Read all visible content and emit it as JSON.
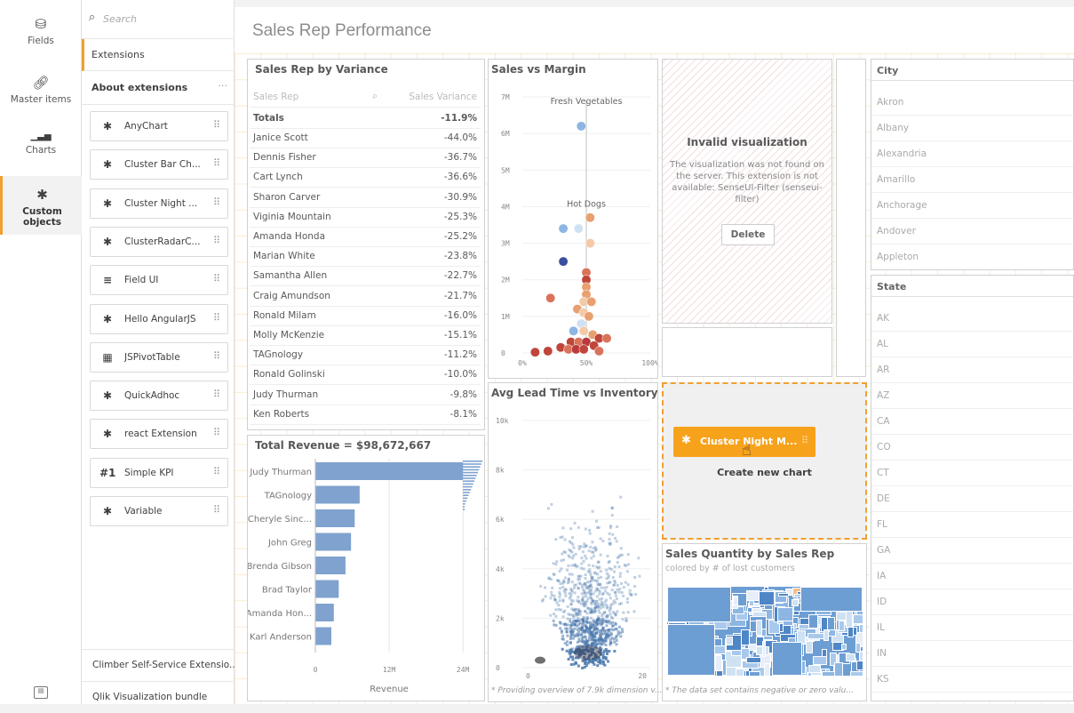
{
  "rail": {
    "items": [
      {
        "label": "Fields",
        "icon": "database-icon"
      },
      {
        "label": "Master items",
        "icon": "link-icon"
      },
      {
        "label": "Charts",
        "icon": "bar-chart-icon"
      },
      {
        "label": "Custom objects",
        "icon": "puzzle-icon"
      }
    ]
  },
  "panel": {
    "search_placeholder": "Search",
    "tab": "Extensions",
    "section": "About extensions",
    "extensions": [
      {
        "label": "AnyChart",
        "icon": "puzzle-icon",
        "glyph": "✱"
      },
      {
        "label": "Cluster Bar Ch...",
        "icon": "puzzle-icon",
        "glyph": "✱"
      },
      {
        "label": "Cluster Night ...",
        "icon": "puzzle-icon",
        "glyph": "✱"
      },
      {
        "label": "ClusterRadarC...",
        "icon": "puzzle-icon",
        "glyph": "✱"
      },
      {
        "label": "Field UI",
        "icon": "list-icon",
        "glyph": "≡"
      },
      {
        "label": "Hello AngularJS",
        "icon": "puzzle-icon",
        "glyph": "✱"
      },
      {
        "label": "JSPivotTable",
        "icon": "table-icon",
        "glyph": "▦"
      },
      {
        "label": "QuickAdhoc",
        "icon": "puzzle-icon",
        "glyph": "✱"
      },
      {
        "label": "react Extension",
        "icon": "puzzle-icon",
        "glyph": "✱"
      },
      {
        "label": "Simple KPI",
        "icon": "kpi-icon",
        "glyph": "#1"
      },
      {
        "label": "Variable",
        "icon": "puzzle-icon",
        "glyph": "✱"
      }
    ],
    "bundles": [
      "Climber Self-Service Extensio...",
      "Qlik Visualization bundle"
    ]
  },
  "sheet": {
    "title": "Sales Rep Performance",
    "variance": {
      "title": "Sales Rep by Variance",
      "col1": "Sales Rep",
      "col2": "Sales Variance",
      "totals_label": "Totals",
      "totals_value": "-11.9%",
      "rows": [
        [
          "Janice Scott",
          "-44.0%"
        ],
        [
          "Dennis Fisher",
          "-36.7%"
        ],
        [
          "Cart Lynch",
          "-36.6%"
        ],
        [
          "Sharon Carver",
          "-30.9%"
        ],
        [
          "Viginia Mountain",
          "-25.3%"
        ],
        [
          "Amanda Honda",
          "-25.2%"
        ],
        [
          "Marian White",
          "-23.8%"
        ],
        [
          "Samantha Allen",
          "-22.7%"
        ],
        [
          "Craig Amundson",
          "-21.7%"
        ],
        [
          "Ronald Milam",
          "-16.0%"
        ],
        [
          "Molly McKenzie",
          "-15.1%"
        ],
        [
          "TAGnology",
          "-11.2%"
        ],
        [
          "Ronald Golinski",
          "-10.0%"
        ],
        [
          "Judy Thurman",
          "-9.8%"
        ],
        [
          "Ken Roberts",
          "-8.1%"
        ]
      ]
    },
    "invalid": {
      "title": "Invalid visualization",
      "message": "The visualization was not found on the server. This extension is not available: SenseUI-Filter (senseui-filter)",
      "button": "Delete"
    },
    "dropzone": {
      "drag_label": "Cluster Night M...",
      "caption": "Create new chart"
    },
    "treemap": {
      "title": "Sales Quantity by Sales Rep",
      "subtitle": "colored by # of lost customers",
      "footnote": "* The data set contains negative or zero valu..."
    },
    "city": {
      "title": "City",
      "values": [
        "Akron",
        "Albany",
        "Alexandria",
        "Amarillo",
        "Anchorage",
        "Andover",
        "Appleton"
      ]
    },
    "state": {
      "title": "State",
      "values": [
        "AK",
        "AL",
        "AR",
        "AZ",
        "CA",
        "CO",
        "CT",
        "DE",
        "FL",
        "GA",
        "IA",
        "ID",
        "IL",
        "IN",
        "KS"
      ]
    }
  },
  "chart_data": [
    {
      "type": "bar",
      "title": "Total Revenue = $98,672,667",
      "xlabel": "Revenue",
      "categories": [
        "Judy Thurman",
        "TAGnology",
        "Cheryle Sinc...",
        "John Greg",
        "Brenda Gibson",
        "Brad Taylor",
        "Amanda Hon...",
        "Karl Anderson"
      ],
      "values": [
        24.0,
        7.2,
        6.4,
        5.8,
        4.9,
        3.8,
        3.0,
        2.6
      ],
      "xlim": [
        0,
        26
      ],
      "xticks": [
        "0",
        "12M",
        "24M"
      ],
      "xtick_values": [
        0,
        12,
        24
      ],
      "color": "#7fa2cf"
    },
    {
      "type": "scatter",
      "title": "Sales vs Margin",
      "yticks": [
        "0",
        "1M",
        "2M",
        "3M",
        "4M",
        "5M",
        "6M",
        "7M"
      ],
      "xticks": [
        "0%",
        "50%",
        "100%"
      ],
      "xlim": [
        0,
        100
      ],
      "ylim": [
        0,
        7
      ],
      "annotations": [
        {
          "text": "Fresh Vegetables",
          "x": 50,
          "y": 6.8
        },
        {
          "text": "Hot Dogs",
          "x": 50,
          "y": 4
        }
      ],
      "points": [
        {
          "x": 46,
          "y": 6.2,
          "c": "#8db6e3"
        },
        {
          "x": 53,
          "y": 3.7,
          "c": "#e8a070"
        },
        {
          "x": 32,
          "y": 3.4,
          "c": "#8db6e3"
        },
        {
          "x": 44,
          "y": 3.4,
          "c": "#cfe2f3"
        },
        {
          "x": 53,
          "y": 3.0,
          "c": "#f4c9a8"
        },
        {
          "x": 32,
          "y": 2.5,
          "c": "#3b4fa0"
        },
        {
          "x": 50,
          "y": 2.2,
          "c": "#d9735a"
        },
        {
          "x": 50,
          "y": 2.0,
          "c": "#c0453a"
        },
        {
          "x": 50,
          "y": 1.8,
          "c": "#e8a070"
        },
        {
          "x": 50,
          "y": 1.6,
          "c": "#e8a070"
        },
        {
          "x": 22,
          "y": 1.5,
          "c": "#d9735a"
        },
        {
          "x": 48,
          "y": 1.4,
          "c": "#f4c9a8"
        },
        {
          "x": 54,
          "y": 1.4,
          "c": "#e8a070"
        },
        {
          "x": 43,
          "y": 1.2,
          "c": "#e8a070"
        },
        {
          "x": 48,
          "y": 1.1,
          "c": "#f4c9a8"
        },
        {
          "x": 52,
          "y": 1.0,
          "c": "#e8a070"
        },
        {
          "x": 46,
          "y": 0.8,
          "c": "#cfe2f3"
        },
        {
          "x": 40,
          "y": 0.6,
          "c": "#8db6e3"
        },
        {
          "x": 48,
          "y": 0.6,
          "c": "#f4c9a8"
        },
        {
          "x": 55,
          "y": 0.5,
          "c": "#e8a070"
        },
        {
          "x": 60,
          "y": 0.4,
          "c": "#c0453a"
        },
        {
          "x": 66,
          "y": 0.4,
          "c": "#d9735a"
        },
        {
          "x": 38,
          "y": 0.3,
          "c": "#c0453a"
        },
        {
          "x": 44,
          "y": 0.3,
          "c": "#d9735a"
        },
        {
          "x": 50,
          "y": 0.3,
          "c": "#b83a3a"
        },
        {
          "x": 56,
          "y": 0.2,
          "c": "#c0453a"
        },
        {
          "x": 30,
          "y": 0.15,
          "c": "#c0453a"
        },
        {
          "x": 36,
          "y": 0.1,
          "c": "#d9735a"
        },
        {
          "x": 42,
          "y": 0.1,
          "c": "#b83a3a"
        },
        {
          "x": 48,
          "y": 0.1,
          "c": "#c0453a"
        },
        {
          "x": 20,
          "y": 0.05,
          "c": "#c0453a"
        },
        {
          "x": 10,
          "y": 0.02,
          "c": "#c0453a"
        },
        {
          "x": 60,
          "y": 0.05,
          "c": "#d9735a"
        }
      ]
    },
    {
      "type": "heatmap",
      "title": "Avg Lead Time vs Inventory",
      "yticks": [
        "0",
        "2k",
        "4k",
        "6k",
        "8k",
        "10k"
      ],
      "xticks": [
        "0",
        "20"
      ],
      "xlim": [
        0,
        20
      ],
      "ylim": [
        0,
        10
      ],
      "footnote": "* Providing overview of 7.9k dimension v..."
    }
  ]
}
